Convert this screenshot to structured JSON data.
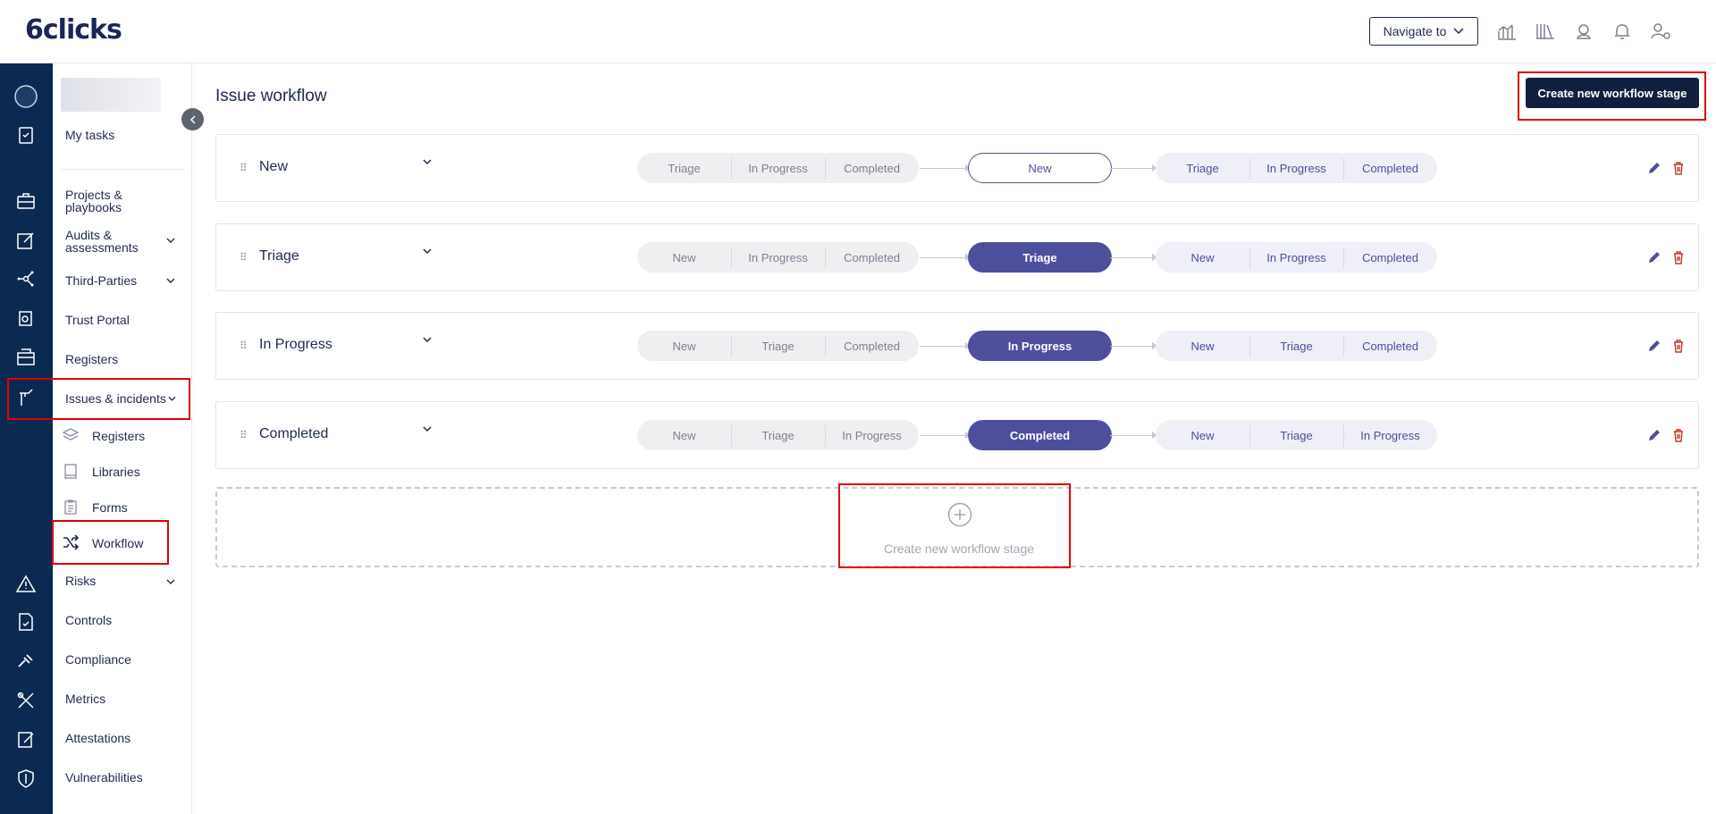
{
  "header": {
    "logo": "6clicks",
    "navigate_label": "Navigate to"
  },
  "sidebar": {
    "my_tasks": "My tasks",
    "items": [
      {
        "label": "Projects & playbooks"
      },
      {
        "label": "Audits & assessments"
      },
      {
        "label": "Third-Parties"
      },
      {
        "label": "Trust Portal"
      },
      {
        "label": "Registers"
      },
      {
        "label": "Issues & incidents"
      },
      {
        "label": "Risks"
      },
      {
        "label": "Controls"
      },
      {
        "label": "Compliance"
      },
      {
        "label": "Metrics"
      },
      {
        "label": "Attestations"
      },
      {
        "label": "Vulnerabilities"
      }
    ],
    "sub_items": [
      {
        "label": "Registers"
      },
      {
        "label": "Libraries"
      },
      {
        "label": "Forms"
      },
      {
        "label": "Workflow"
      }
    ]
  },
  "main": {
    "title": "Issue workflow",
    "create_button": "Create new workflow stage",
    "stages": [
      {
        "name": "New",
        "prev": [
          "Triage",
          "In Progress",
          "Completed"
        ],
        "current": "New",
        "next": [
          "Triage",
          "In Progress",
          "Completed"
        ]
      },
      {
        "name": "Triage",
        "prev": [
          "New",
          "In Progress",
          "Completed"
        ],
        "current": "Triage",
        "next": [
          "New",
          "In Progress",
          "Completed"
        ]
      },
      {
        "name": "In Progress",
        "prev": [
          "New",
          "Triage",
          "Completed"
        ],
        "current": "In Progress",
        "next": [
          "New",
          "Triage",
          "Completed"
        ]
      },
      {
        "name": "Completed",
        "prev": [
          "New",
          "Triage",
          "In Progress"
        ],
        "current": "Completed",
        "next": [
          "New",
          "Triage",
          "In Progress"
        ]
      }
    ],
    "add_stage_label": "Create new workflow stage"
  },
  "colors": {
    "rail": "#0b2a52",
    "accent": "#4e4f9c",
    "primary_button": "#0f1f3d",
    "highlight": "#e00000",
    "delete": "#c0392b"
  }
}
